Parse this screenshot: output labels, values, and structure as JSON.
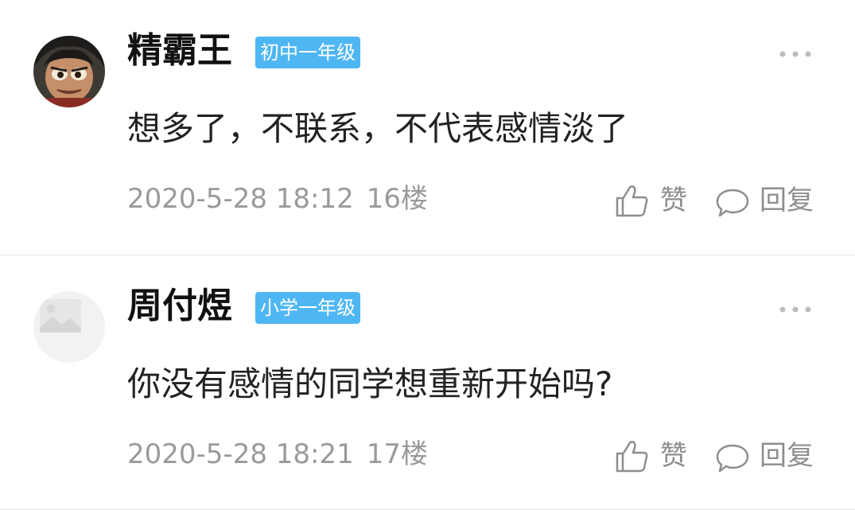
{
  "comments": [
    {
      "username": "精霸王",
      "badge": "初中一年级",
      "content": "想多了，不联系，不代表感情淡了",
      "datetime": "2020-5-28 18:12",
      "floor": "16楼",
      "like_label": "赞",
      "reply_label": "回复",
      "badge_color": "#4fb6f4"
    },
    {
      "username": "周付煜",
      "badge": "小学一年级",
      "content": "你没有感情的同学想重新开始吗?",
      "datetime": "2020-5-28 18:21",
      "floor": "17楼",
      "like_label": "赞",
      "reply_label": "回复",
      "badge_color": "#4fb6f4"
    }
  ],
  "icons": {
    "like": "thumbs-up-icon",
    "reply": "speech-bubble-icon",
    "more": "more-dots-icon",
    "placeholder_avatar": "image-placeholder-icon"
  }
}
